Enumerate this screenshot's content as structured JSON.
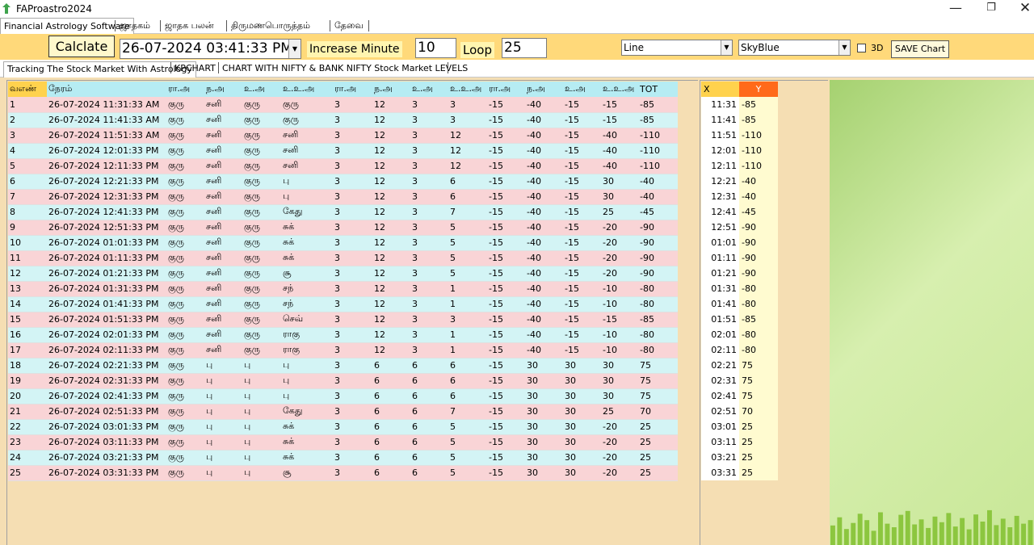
{
  "window": {
    "title": "FAProastro2024",
    "minimize": "—",
    "maximize": "❐",
    "close": "✕"
  },
  "main_tabs": [
    "Financial Astrology Software",
    "ஜாதகம்",
    "ஜாதக பலன்",
    "திருமணபொருத்தம்",
    "தேவை"
  ],
  "toolbar": {
    "calc_label": "Calclate",
    "datetime_value": "26-07-2024 03:41:33 PM",
    "increase_label": "Increase Minute",
    "minute_value": "10",
    "loop_label": "Loop",
    "loop_value": "25",
    "chart_type": "Line",
    "chart_color": "SkyBlue",
    "three_d_label": "3D",
    "save_label": "SAVE Chart"
  },
  "sub_tabs": [
    "Tracking The Stock Market With Astrology",
    "KPCHART",
    "CHART WITH NIFTY & BANK NIFTY Stock Market LEVELS"
  ],
  "table": {
    "headers": [
      "வஎண்",
      "நேரம்",
      "ரா.அ",
      "ந.அ",
      "உ.அ",
      "உ.உ.அ",
      "ரா.அ",
      "ந.அ",
      "உ.அ",
      "உ.உ.அ",
      "ரா.அ",
      "ந.அ",
      "உ.அ",
      "உ.உ.அ",
      "TOT"
    ],
    "rows": [
      [
        "1",
        "26-07-2024 11:31:33 AM",
        "குரு",
        "சனி",
        "குரு",
        "குரு",
        "3",
        "12",
        "3",
        "3",
        "-15",
        "-40",
        "-15",
        "-15",
        "-85"
      ],
      [
        "2",
        "26-07-2024 11:41:33 AM",
        "குரு",
        "சனி",
        "குரு",
        "குரு",
        "3",
        "12",
        "3",
        "3",
        "-15",
        "-40",
        "-15",
        "-15",
        "-85"
      ],
      [
        "3",
        "26-07-2024 11:51:33 AM",
        "குரு",
        "சனி",
        "குரு",
        "சனி",
        "3",
        "12",
        "3",
        "12",
        "-15",
        "-40",
        "-15",
        "-40",
        "-110"
      ],
      [
        "4",
        "26-07-2024 12:01:33 PM",
        "குரு",
        "சனி",
        "குரு",
        "சனி",
        "3",
        "12",
        "3",
        "12",
        "-15",
        "-40",
        "-15",
        "-40",
        "-110"
      ],
      [
        "5",
        "26-07-2024 12:11:33 PM",
        "குரு",
        "சனி",
        "குரு",
        "சனி",
        "3",
        "12",
        "3",
        "12",
        "-15",
        "-40",
        "-15",
        "-40",
        "-110"
      ],
      [
        "6",
        "26-07-2024 12:21:33 PM",
        "குரு",
        "சனி",
        "குரு",
        "பு",
        "3",
        "12",
        "3",
        "6",
        "-15",
        "-40",
        "-15",
        "30",
        "-40"
      ],
      [
        "7",
        "26-07-2024 12:31:33 PM",
        "குரு",
        "சனி",
        "குரு",
        "பு",
        "3",
        "12",
        "3",
        "6",
        "-15",
        "-40",
        "-15",
        "30",
        "-40"
      ],
      [
        "8",
        "26-07-2024 12:41:33 PM",
        "குரு",
        "சனி",
        "குரு",
        "கேது",
        "3",
        "12",
        "3",
        "7",
        "-15",
        "-40",
        "-15",
        "25",
        "-45"
      ],
      [
        "9",
        "26-07-2024 12:51:33 PM",
        "குரு",
        "சனி",
        "குரு",
        "சுக்",
        "3",
        "12",
        "3",
        "5",
        "-15",
        "-40",
        "-15",
        "-20",
        "-90"
      ],
      [
        "10",
        "26-07-2024 01:01:33 PM",
        "குரு",
        "சனி",
        "குரு",
        "சுக்",
        "3",
        "12",
        "3",
        "5",
        "-15",
        "-40",
        "-15",
        "-20",
        "-90"
      ],
      [
        "11",
        "26-07-2024 01:11:33 PM",
        "குரு",
        "சனி",
        "குரு",
        "சுக்",
        "3",
        "12",
        "3",
        "5",
        "-15",
        "-40",
        "-15",
        "-20",
        "-90"
      ],
      [
        "12",
        "26-07-2024 01:21:33 PM",
        "குரு",
        "சனி",
        "குரு",
        "சூ",
        "3",
        "12",
        "3",
        "5",
        "-15",
        "-40",
        "-15",
        "-20",
        "-90"
      ],
      [
        "13",
        "26-07-2024 01:31:33 PM",
        "குரு",
        "சனி",
        "குரு",
        "சந்",
        "3",
        "12",
        "3",
        "1",
        "-15",
        "-40",
        "-15",
        "-10",
        "-80"
      ],
      [
        "14",
        "26-07-2024 01:41:33 PM",
        "குரு",
        "சனி",
        "குரு",
        "சந்",
        "3",
        "12",
        "3",
        "1",
        "-15",
        "-40",
        "-15",
        "-10",
        "-80"
      ],
      [
        "15",
        "26-07-2024 01:51:33 PM",
        "குரு",
        "சனி",
        "குரு",
        "செவ்",
        "3",
        "12",
        "3",
        "3",
        "-15",
        "-40",
        "-15",
        "-15",
        "-85"
      ],
      [
        "16",
        "26-07-2024 02:01:33 PM",
        "குரு",
        "சனி",
        "குரு",
        "ராகு",
        "3",
        "12",
        "3",
        "1",
        "-15",
        "-40",
        "-15",
        "-10",
        "-80"
      ],
      [
        "17",
        "26-07-2024 02:11:33 PM",
        "குரு",
        "சனி",
        "குரு",
        "ராகு",
        "3",
        "12",
        "3",
        "1",
        "-15",
        "-40",
        "-15",
        "-10",
        "-80"
      ],
      [
        "18",
        "26-07-2024 02:21:33 PM",
        "குரு",
        "பு",
        "பு",
        "பு",
        "3",
        "6",
        "6",
        "6",
        "-15",
        "30",
        "30",
        "30",
        "75"
      ],
      [
        "19",
        "26-07-2024 02:31:33 PM",
        "குரு",
        "பு",
        "பு",
        "பு",
        "3",
        "6",
        "6",
        "6",
        "-15",
        "30",
        "30",
        "30",
        "75"
      ],
      [
        "20",
        "26-07-2024 02:41:33 PM",
        "குரு",
        "பு",
        "பு",
        "பு",
        "3",
        "6",
        "6",
        "6",
        "-15",
        "30",
        "30",
        "30",
        "75"
      ],
      [
        "21",
        "26-07-2024 02:51:33 PM",
        "குரு",
        "பு",
        "பு",
        "கேது",
        "3",
        "6",
        "6",
        "7",
        "-15",
        "30",
        "30",
        "25",
        "70"
      ],
      [
        "22",
        "26-07-2024 03:01:33 PM",
        "குரு",
        "பு",
        "பு",
        "சுக்",
        "3",
        "6",
        "6",
        "5",
        "-15",
        "30",
        "30",
        "-20",
        "25"
      ],
      [
        "23",
        "26-07-2024 03:11:33 PM",
        "குரு",
        "பு",
        "பு",
        "சுக்",
        "3",
        "6",
        "6",
        "5",
        "-15",
        "30",
        "30",
        "-20",
        "25"
      ],
      [
        "24",
        "26-07-2024 03:21:33 PM",
        "குரு",
        "பு",
        "பு",
        "சுக்",
        "3",
        "6",
        "6",
        "5",
        "-15",
        "30",
        "30",
        "-20",
        "25"
      ],
      [
        "25",
        "26-07-2024 03:31:33 PM",
        "குரு",
        "பு",
        "பு",
        "சூ",
        "3",
        "6",
        "6",
        "5",
        "-15",
        "30",
        "30",
        "-20",
        "25"
      ]
    ]
  },
  "xy_table": {
    "headers": [
      "X",
      "Y"
    ],
    "rows": [
      [
        "11:31",
        "-85"
      ],
      [
        "11:41",
        "-85"
      ],
      [
        "11:51",
        "-110"
      ],
      [
        "12:01",
        "-110"
      ],
      [
        "12:11",
        "-110"
      ],
      [
        "12:21",
        "-40"
      ],
      [
        "12:31",
        "-40"
      ],
      [
        "12:41",
        "-45"
      ],
      [
        "12:51",
        "-90"
      ],
      [
        "01:01",
        "-90"
      ],
      [
        "01:11",
        "-90"
      ],
      [
        "01:21",
        "-90"
      ],
      [
        "01:31",
        "-80"
      ],
      [
        "01:41",
        "-80"
      ],
      [
        "01:51",
        "-85"
      ],
      [
        "02:01",
        "-80"
      ],
      [
        "02:11",
        "-80"
      ],
      [
        "02:21",
        "75"
      ],
      [
        "02:31",
        "75"
      ],
      [
        "02:41",
        "75"
      ],
      [
        "02:51",
        "70"
      ],
      [
        "03:01",
        "25"
      ],
      [
        "03:11",
        "25"
      ],
      [
        "03:21",
        "25"
      ],
      [
        "03:31",
        "25"
      ]
    ]
  },
  "chart_bars": {
    "values": [
      0.55,
      0.78,
      0.45,
      0.62,
      0.88,
      0.7,
      0.4,
      0.92,
      0.6,
      0.5,
      0.85,
      0.96,
      0.58,
      0.72,
      0.48,
      0.8,
      0.64,
      0.9,
      0.52,
      0.76,
      0.44,
      0.86,
      0.66,
      0.98,
      0.56,
      0.74,
      0.5,
      0.82,
      0.6,
      0.7
    ],
    "color": "#8cc63f"
  },
  "colors": {
    "toolbar_bg": "#ffd97a",
    "row_pink": "#f9d4d6",
    "row_cyan": "#d3f4f5",
    "content_bg": "#f5deb3"
  }
}
